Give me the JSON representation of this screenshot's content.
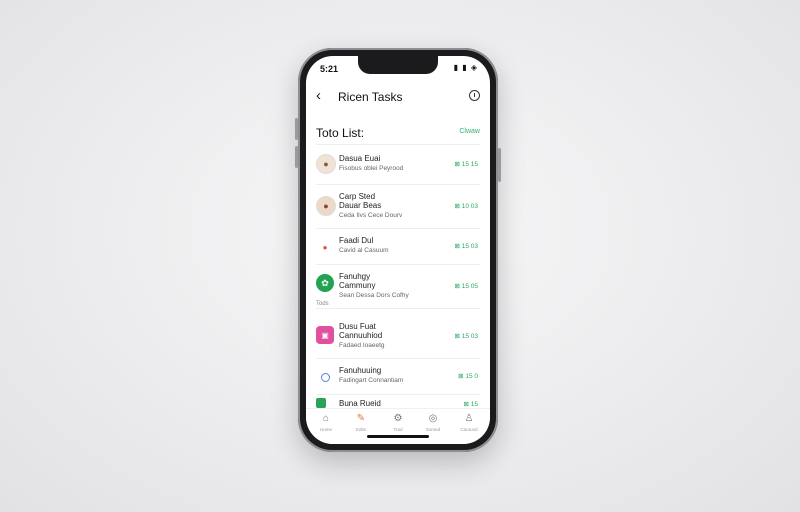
{
  "status": {
    "time": "5:21",
    "icons": "▮ ▮ ◈"
  },
  "nav": {
    "title": "Ricen Tasks"
  },
  "section": {
    "title": "Toto List:",
    "link": "Clwaw"
  },
  "group_label": "Tods",
  "tasks": [
    {
      "title": "Dasua Euai",
      "subtitle": "Fisobus oblei Peyrood",
      "time": "⊠ 15 15",
      "avatar": "person-avatar",
      "avatar_color": "#8a5a3c"
    },
    {
      "title": "Carp Sted",
      "title2": "Dauar Beas",
      "subtitle": "Ceda Ilvs Cece Dourv",
      "time": "⊠ 10 03",
      "avatar": "person-avatar",
      "avatar_color": "#7b4a34"
    },
    {
      "title": "Faadi Dul",
      "subtitle": "Cavid al Casuum",
      "time": "⊠ 15 03",
      "avatar": "red-dot-icon",
      "avatar_color": "#e24b4b"
    },
    {
      "title": "Fanuhgy",
      "title2": "Cammuny",
      "subtitle": "Sean Dessa Dors Cofhy",
      "time": "⊠ 15 05",
      "avatar": "leaf-icon",
      "avatar_color": "#22a354"
    },
    {
      "title": "Dusu Fuat",
      "title2": "Cannuuhiod",
      "subtitle": "Fadaed Ioaeetg",
      "time": "⊠ 15 03",
      "avatar": "photo-icon",
      "avatar_color": "#e0509f"
    },
    {
      "title": "Fanuhuuing",
      "subtitle": "Fadingart Connantiam",
      "time": "⊠ 15 0",
      "avatar": "circle-icon",
      "avatar_color": "#5a7fd6"
    },
    {
      "title": "Buna Rueid",
      "subtitle": "",
      "time": "⊠ 15",
      "avatar": "green-square-icon",
      "avatar_color": "#2da15a"
    }
  ],
  "tabs": [
    {
      "label": "Home",
      "icon": "house-icon"
    },
    {
      "label": "Edits",
      "icon": "pencil-icon"
    },
    {
      "label": "Trad",
      "icon": "gear-icon"
    },
    {
      "label": "Somed",
      "icon": "camera-icon"
    },
    {
      "label": "Caround",
      "icon": "person-icon"
    }
  ]
}
